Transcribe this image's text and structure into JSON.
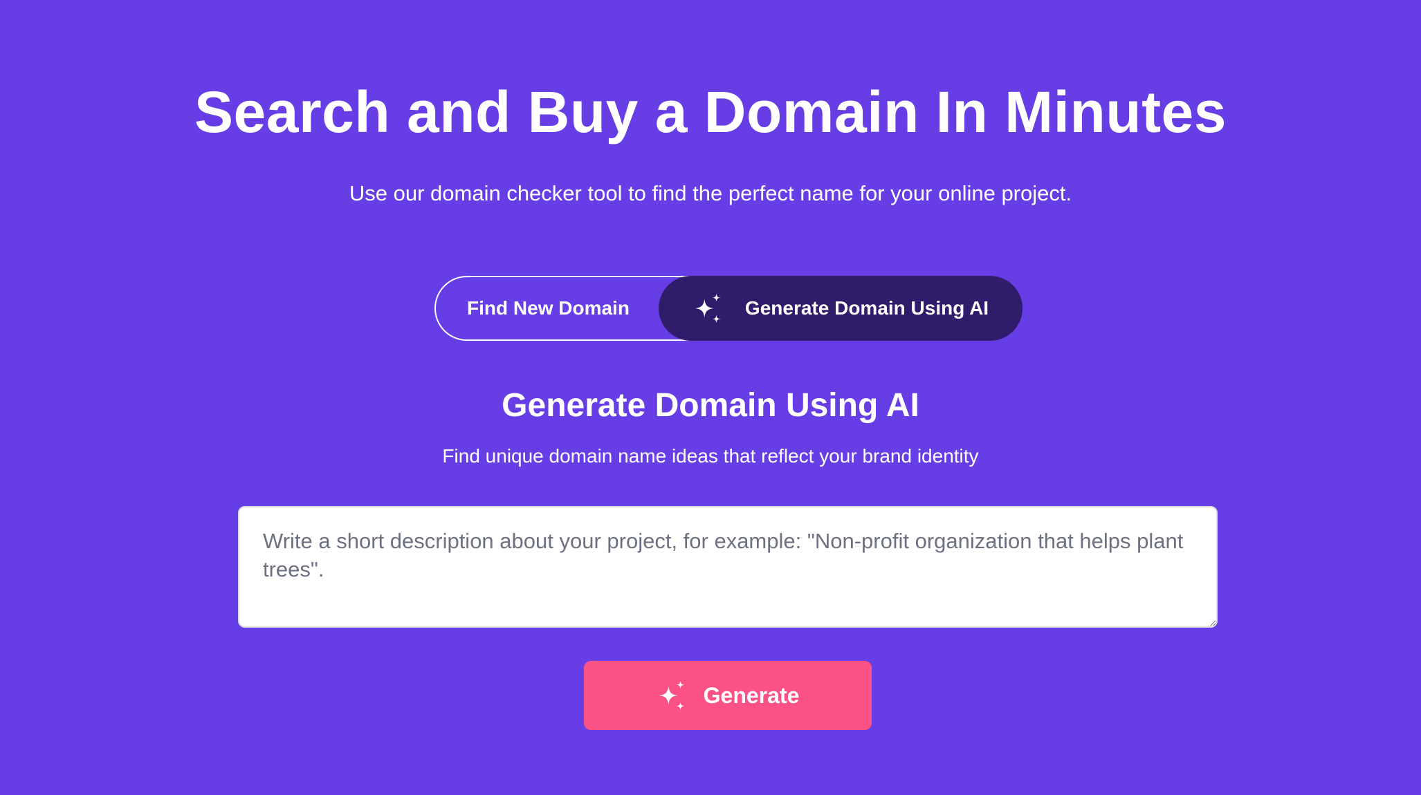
{
  "hero": {
    "title": "Search and Buy a Domain In Minutes",
    "subtitle": "Use our domain checker tool to find the perfect name for your online project."
  },
  "tabs": [
    {
      "label": "Find New Domain",
      "selected": false
    },
    {
      "label": "Generate Domain Using AI",
      "selected": true,
      "icon": "sparkle-icon"
    }
  ],
  "ai_section": {
    "title": "Generate Domain Using AI",
    "subtitle": "Find unique domain name ideas that reflect your brand identity",
    "input": {
      "value": "",
      "placeholder": "Write a short description about your project, for example: \"Non-profit organization that helps plant trees\"."
    },
    "generate_button": {
      "label": "Generate",
      "icon": "sparkle-icon"
    }
  },
  "colors": {
    "background": "#673DE6",
    "selected_tab": "#2F1C6A",
    "button": "#FC5185",
    "text": "#FFFFFF"
  }
}
